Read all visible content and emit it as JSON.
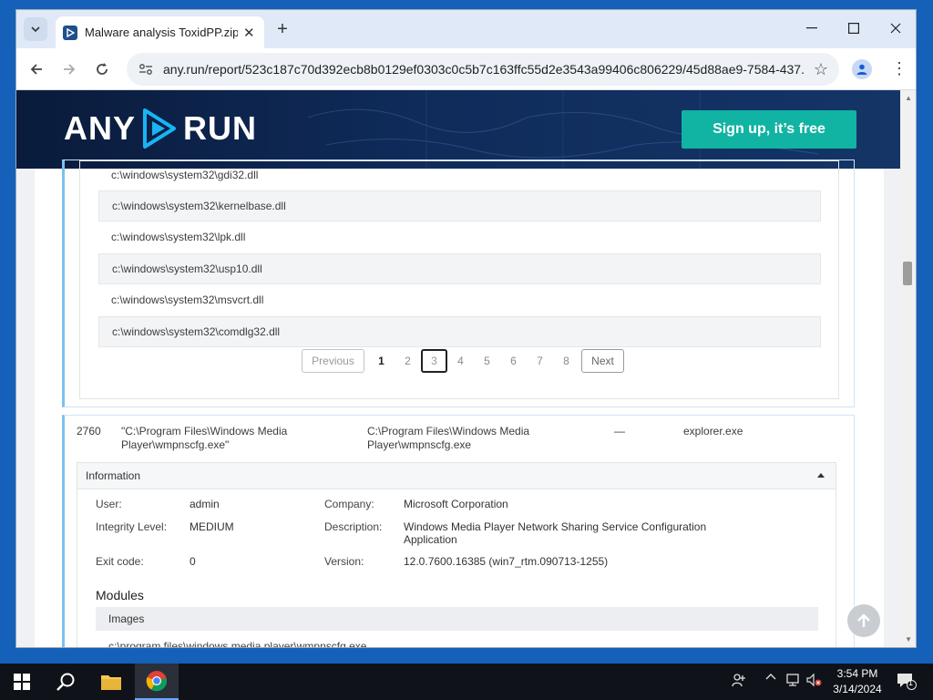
{
  "browser": {
    "tab_title": "Malware analysis ToxidPP.zip M",
    "url": "any.run/report/523c187c70d392ecb8b0129ef0303c0c5b7c163ffc55d2e3543a99406c806229/45d88ae9-7584-437..."
  },
  "banner": {
    "logo_left": "ANY",
    "logo_right": "RUN",
    "signup_label": "Sign up, it’s free"
  },
  "dll_list": [
    "c:\\windows\\system32\\gdi32.dll",
    "c:\\windows\\system32\\kernelbase.dll",
    "c:\\windows\\system32\\lpk.dll",
    "c:\\windows\\system32\\usp10.dll",
    "c:\\windows\\system32\\msvcrt.dll",
    "c:\\windows\\system32\\comdlg32.dll"
  ],
  "pagination": {
    "previous": "Previous",
    "next": "Next",
    "pages": [
      "1",
      "2",
      "3",
      "4",
      "5",
      "6",
      "7",
      "8"
    ],
    "current": "3"
  },
  "process": {
    "pid": "2760",
    "cmd": "\"C:\\Program Files\\Windows Media Player\\wmpnscfg.exe\"",
    "path": "C:\\Program Files\\Windows Media Player\\wmpnscfg.exe",
    "dash": "—",
    "parent": "explorer.exe"
  },
  "information": {
    "header": "Information",
    "user_label": "User:",
    "user": "admin",
    "integrity_label": "Integrity Level:",
    "integrity": "MEDIUM",
    "exit_label": "Exit code:",
    "exit": "0",
    "company_label": "Company:",
    "company": "Microsoft Corporation",
    "description_label": "Description:",
    "description": "Windows Media Player Network Sharing Service Configuration Application",
    "version_label": "Version:",
    "version": "12.0.7600.16385 (win7_rtm.090713-1255)"
  },
  "modules": {
    "title": "Modules",
    "images_header": "Images",
    "first_image": "c:\\program files\\windows media player\\wmpnscfg.exe"
  },
  "taskbar": {
    "time": "3:54 PM",
    "date": "3/14/2024",
    "notification_count": "1"
  }
}
